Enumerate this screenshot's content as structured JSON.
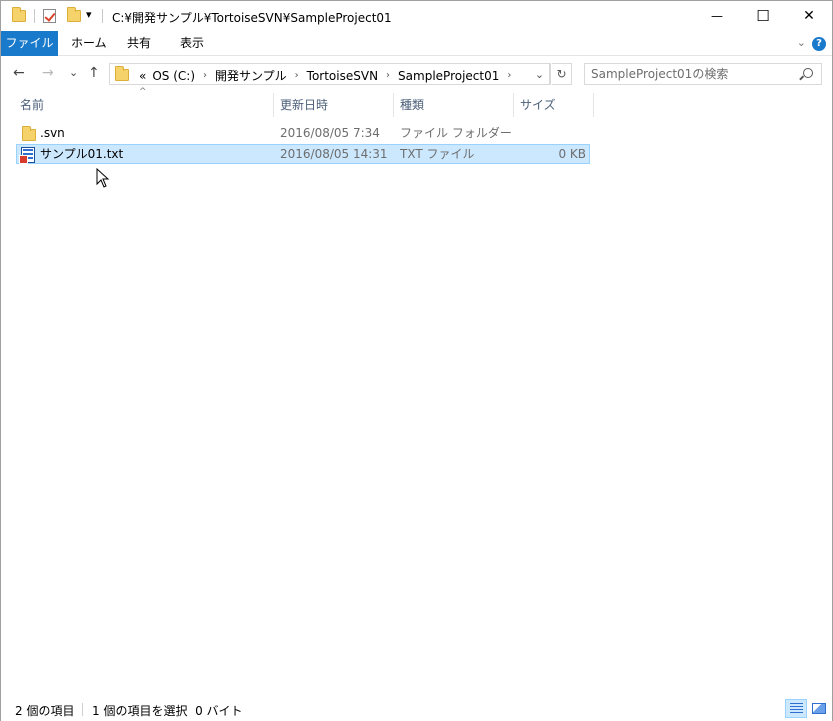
{
  "window": {
    "title": "C:¥開発サンプル¥TortoiseSVN¥SampleProject01",
    "minimize_glyph": "—",
    "maximize_glyph": "☐",
    "close_glyph": "✕"
  },
  "quick_access": {
    "dropdown_glyph": "▾"
  },
  "ribbon": {
    "tabs": [
      {
        "label": "ファイル",
        "active": true
      },
      {
        "label": "ホーム"
      },
      {
        "label": "共有"
      },
      {
        "label": "表示"
      }
    ],
    "expand_glyph": "⌄",
    "help_glyph": "?"
  },
  "nav": {
    "back_glyph": "←",
    "forward_glyph": "→",
    "recent_glyph": "⌄",
    "up_glyph": "↑",
    "overflow": "«",
    "breadcrumbs": [
      "OS (C:)",
      "開発サンプル",
      "TortoiseSVN",
      "SampleProject01"
    ],
    "crumb_sep": "›",
    "dropdown_glyph": "⌄",
    "refresh_glyph": "↻"
  },
  "search": {
    "placeholder": "SampleProject01の検索"
  },
  "columns": {
    "name": "名前",
    "modified": "更新日時",
    "type": "種類",
    "size": "サイズ",
    "sort_glyph": "^"
  },
  "files": [
    {
      "name": ".svn",
      "modified": "2016/08/05 7:34",
      "type": "ファイル フォルダー",
      "size": "",
      "icon": "folder-icon",
      "selected": false
    },
    {
      "name": "サンプル01.txt",
      "modified": "2016/08/05 14:31",
      "type": "TXT ファイル",
      "size": "0 KB",
      "icon": "text-file-icon",
      "selected": true
    }
  ],
  "status": {
    "item_count": "2 個の項目",
    "selection": "1 個の項目を選択  0 バイト"
  },
  "colors": {
    "accent": "#1979ca",
    "selection_bg": "#cce8ff",
    "selection_border": "#99d1ff",
    "header_text": "#4c607a",
    "muted_text": "#6d6d6d"
  }
}
